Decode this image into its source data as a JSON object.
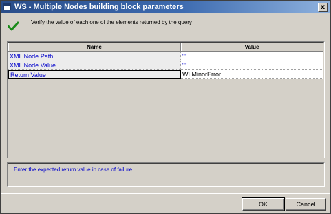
{
  "window": {
    "title": "WS - Multiple Nodes building block parameters",
    "close_label": "x"
  },
  "header": {
    "icon": "checkmark-icon",
    "text": "Verify the value of each one of the elements returned by the query"
  },
  "grid": {
    "columns": {
      "name": "Name",
      "value": "Value"
    },
    "rows": [
      {
        "name": "XML Node Path",
        "value": "\"\""
      },
      {
        "name": "XML Node Value",
        "value": "\"\""
      },
      {
        "name": "Return Value",
        "value": "WLMinorError"
      }
    ],
    "selected_row": "Return Value"
  },
  "description": {
    "text": "Enter the expected return value in case of failure"
  },
  "buttons": {
    "ok": "OK",
    "cancel": "Cancel"
  },
  "colors": {
    "titlebar_start": "#2a4d8a",
    "titlebar_end": "#8fb2de",
    "link_text": "#0000cc",
    "checkmark": "#1a8a1a"
  }
}
